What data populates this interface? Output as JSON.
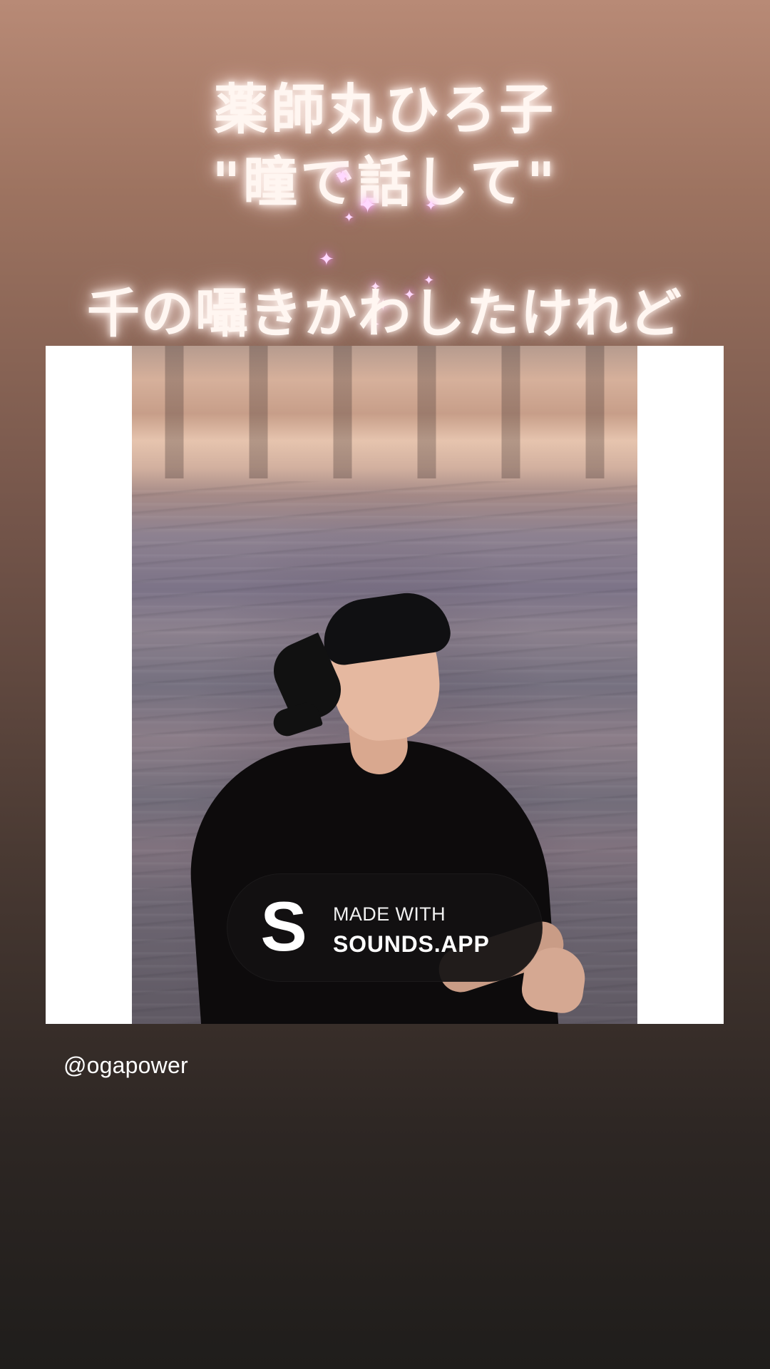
{
  "story": {
    "title_line_1": "薬師丸ひろ子",
    "title_line_2": "\"瞳で話して\"",
    "lyric_line": "千の囁きかわしたけれど",
    "badge": {
      "logo_text": "S",
      "caption": "MADE WITH",
      "brand": "SOUNDS.APP"
    },
    "mention": "@ogapower"
  }
}
